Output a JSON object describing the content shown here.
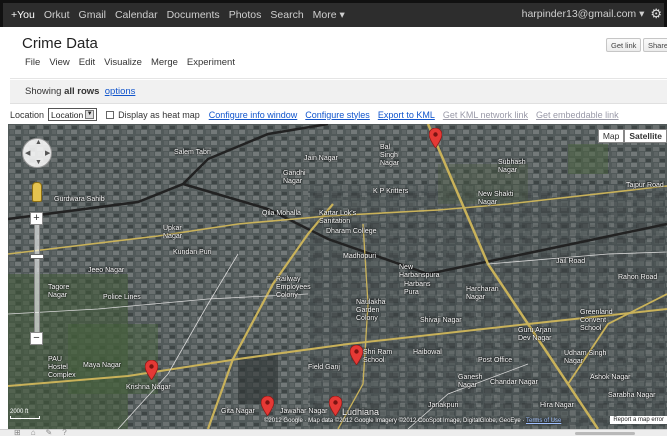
{
  "gbar": {
    "links": [
      "+You",
      "Orkut",
      "Gmail",
      "Calendar",
      "Documents",
      "Photos",
      "Search",
      "More ▾"
    ],
    "account": "harpinder13@gmail.com ▾",
    "settings_icon": "gear-icon"
  },
  "header": {
    "title": "Crime Data",
    "get_link": "Get link",
    "share": "Share"
  },
  "menu": [
    "File",
    "View",
    "Edit",
    "Visualize",
    "Merge",
    "Experiment"
  ],
  "filter": {
    "prefix": "Showing ",
    "rows": "all rows",
    "options_link": "options"
  },
  "toolbar": {
    "location_label": "Location",
    "location_value": "Location",
    "heatmap_label": "Display as heat map",
    "links": [
      "Configure info window",
      "Configure styles",
      "Export to KML"
    ],
    "disabled_links": [
      "Get KML network link",
      "Get embeddable link"
    ]
  },
  "map": {
    "map_type_buttons": [
      "Map",
      "Satellite"
    ],
    "active_type": "Satellite",
    "zoom_in": "+",
    "zoom_out": "−",
    "places": [
      "Salem Tabri",
      "Jain Nagar",
      "Bal Singh Nagar",
      "Subhash Nagar",
      "Gandhi Nagar",
      "K P Kritters",
      "New Shakti Nagar",
      "Qila Mohalla",
      "Kartar Lok's Sanitation",
      "Dharam College",
      "Gurdwara Sahib",
      "Upkar Nagar",
      "Kundan Puri",
      "Madhopuri",
      "New Harbanspura",
      "Harbans Pura",
      "Jeeo Nagar",
      "Tagore Nagar",
      "Police Lines",
      "Railway Employees Colony",
      "Naulakha Garden Colony",
      "Harcharan Nagar",
      "Guru Arjan Dev Nagar",
      "Jail Road",
      "Tajpur Road",
      "Shivaji Nagar",
      "Greenland Convent School",
      "Udham Singh Nagar",
      "PAU Hostel Complex",
      "Maya Nagar",
      "Krishna Nagar",
      "Field Ganj",
      "Shri Ram School",
      "Haibowal",
      "Post Office",
      "Ganesh Nagar",
      "Gita Nagar",
      "Jawahar Nagar",
      "Ludhiana",
      "Janakpuri",
      "Hira Nagar",
      "Rahon Road",
      "Sarabha Nagar",
      "Ashok Nagar",
      "Chandar Nagar"
    ],
    "scale_label": "2000 ft",
    "copyright": "©2012 Google · Map data ©2012 Google Imagery ©2012 CooSpot Image, DigitalGlobe, GeoEye · ",
    "terms_link": "Terms of Use",
    "report_link": "Report a map error",
    "marker_count": 5
  },
  "colors": {
    "gbar_bg": "#2d2d2d",
    "link": "#1155cc",
    "marker": "#e53935"
  }
}
